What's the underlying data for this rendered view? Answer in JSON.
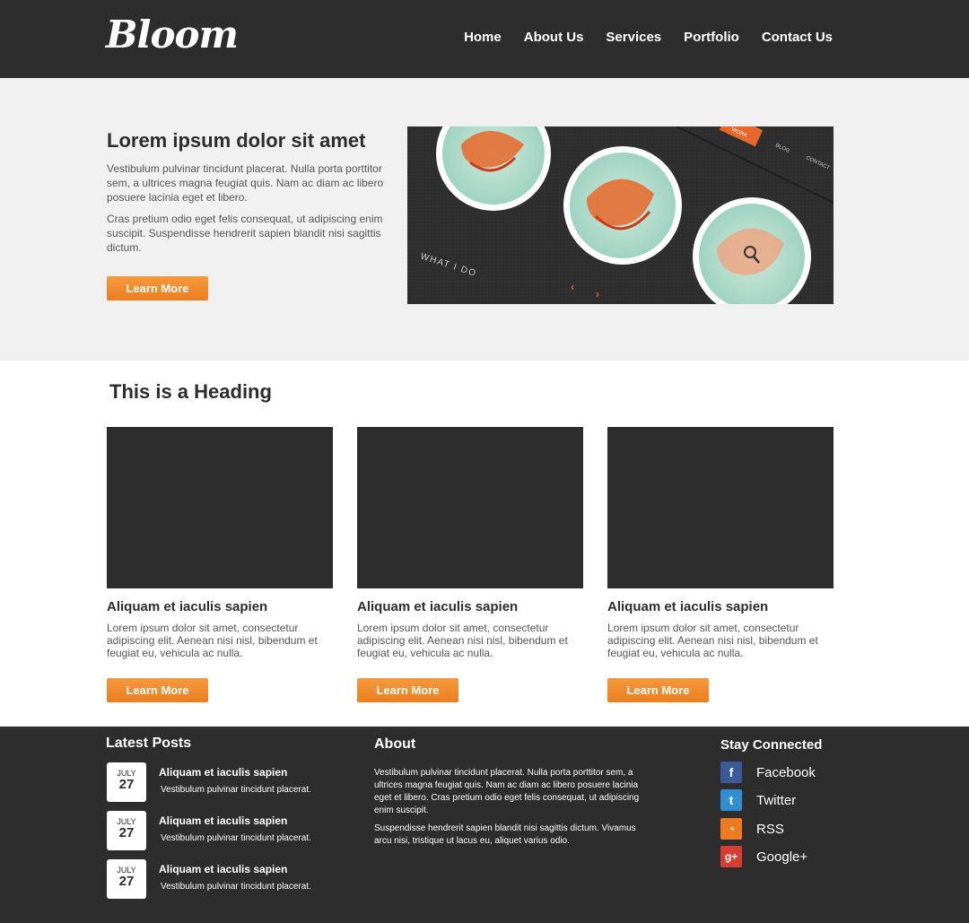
{
  "header": {
    "logo": "Bloom",
    "nav": [
      "Home",
      "About Us",
      "Services",
      "Portfolio",
      "Contact Us"
    ]
  },
  "hero": {
    "title": "Lorem ipsum dolor sit amet",
    "p1": "Vestibulum pulvinar tincidunt placerat. Nulla porta porttitor sem, a ultrices magna feugiat quis. Nam ac diam ac libero posuere lacinia eget et libero.",
    "p2": "Cras pretium odio eget felis consequat, ut adipiscing enim suscipit. Suspendisse hendrerit sapien blandit nisi sagittis dictum.",
    "button": "Learn More",
    "image_labels": [
      "WHAT I DO",
      "WORK",
      "BLOG",
      "CONTACT"
    ]
  },
  "features": {
    "heading": "This is a Heading",
    "cards": [
      {
        "title": "Aliquam et iaculis sapien",
        "text": "Lorem ipsum dolor sit amet, consectetur adipiscing elit. Aenean nisi nisl, bibendum et feugiat eu, vehicula ac nulla.",
        "button": "Learn More"
      },
      {
        "title": "Aliquam et iaculis sapien",
        "text": "Lorem ipsum dolor sit amet, consectetur adipiscing elit. Aenean nisi nisl, bibendum et feugiat eu, vehicula ac nulla.",
        "button": "Learn More"
      },
      {
        "title": "Aliquam et iaculis sapien",
        "text": "Lorem ipsum dolor sit amet, consectetur adipiscing elit. Aenean nisi nisl, bibendum et feugiat eu, vehicula ac nulla.",
        "button": "Learn More"
      }
    ]
  },
  "footer": {
    "latest_title": "Latest Posts",
    "posts": [
      {
        "month": "JULY",
        "day": "27",
        "title": "Aliquam et iaculis sapien",
        "sub": "Vestibulum pulvinar tincidunt placerat."
      },
      {
        "month": "JULY",
        "day": "27",
        "title": "Aliquam et iaculis sapien",
        "sub": "Vestibulum pulvinar tincidunt placerat."
      },
      {
        "month": "JULY",
        "day": "27",
        "title": "Aliquam et iaculis sapien",
        "sub": "Vestibulum pulvinar tincidunt placerat."
      }
    ],
    "about_title": "About",
    "about_p1": "Vestibulum pulvinar tincidunt placerat. Nulla porta porttitor sem, a ultrices magna feugiat quis. Nam ac diam ac libero posuere lacinia eget et libero. Cras pretium odio eget felis consequat, ut adipiscing enim suscipit.",
    "about_p2": "Suspendisse hendrerit sapien blandit nisi sagittis dictum. Vivamus arcu nisi, tristique ut lacus eu, aliquet varius odio.",
    "social_title": "Stay Connected",
    "social": [
      {
        "label": "Facebook",
        "icon": "facebook-icon",
        "glyph": "f",
        "color": "#3b5998"
      },
      {
        "label": "Twitter",
        "icon": "twitter-icon",
        "glyph": "t",
        "color": "#2f8fd1"
      },
      {
        "label": "RSS",
        "icon": "rss-icon",
        "glyph": "◔",
        "color": "#ef7a1f"
      },
      {
        "label": "Google+",
        "icon": "google-plus-icon",
        "glyph": "g+",
        "color": "#d73d32"
      }
    ]
  },
  "colors": {
    "dark": "#2d2d2d",
    "accent": "#f08a2b",
    "hero_bg": "#f0f0f0"
  }
}
